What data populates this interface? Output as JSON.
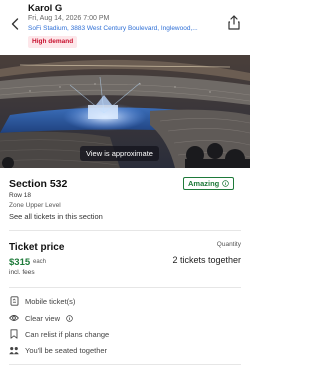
{
  "header": {
    "title": "Karol G",
    "date": "Fri, Aug 14, 2026 7:00 PM",
    "venue": "SoFi Stadium, 3883 West Century Boulevard, Inglewood,...",
    "demand_badge": "High demand",
    "icons": {
      "back": "chevron-left-icon",
      "share": "share-icon",
      "badge": "info-icon"
    }
  },
  "view": {
    "caption": "View is approximate"
  },
  "section": {
    "title": "Section 532",
    "row": "Row 18",
    "zone": "Zone Upper Level",
    "see_all": "See all tickets in this section",
    "rating": "Amazing"
  },
  "price": {
    "heading": "Ticket price",
    "value": "$315",
    "unit": "each",
    "fees": "incl. fees",
    "quantity_label": "Quantity",
    "quantity_value": "2 tickets together"
  },
  "features": [
    {
      "icon": "mobile-ticket-icon",
      "label": "Mobile ticket(s)"
    },
    {
      "icon": "eye-icon",
      "label": "Clear view"
    },
    {
      "icon": "bookmark-icon",
      "label": "Can relist if plans change"
    },
    {
      "icon": "group-icon",
      "label": "You'll be seated together"
    }
  ],
  "colors": {
    "accent_green": "#1e7a3a",
    "link_blue": "#2e6fd6",
    "demand_red": "#c8102e"
  }
}
